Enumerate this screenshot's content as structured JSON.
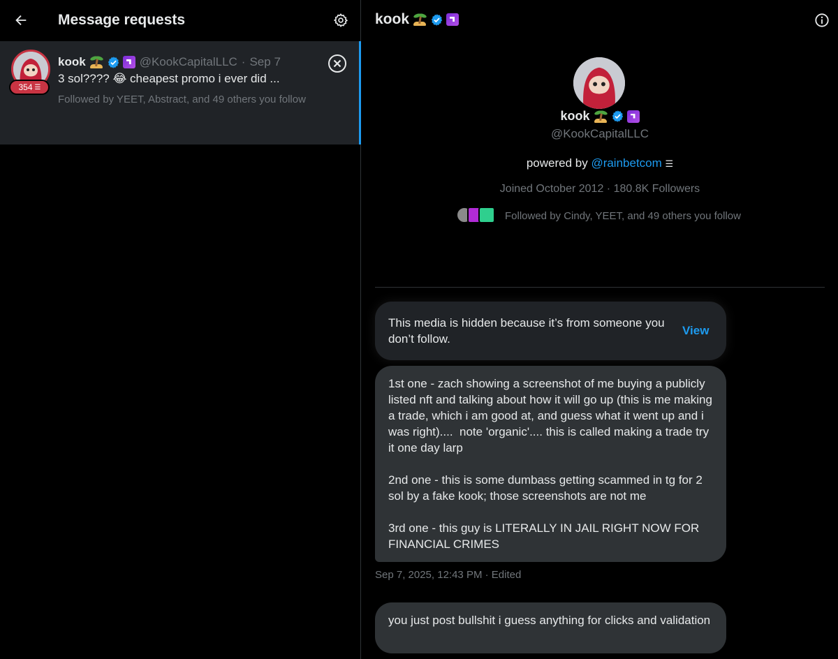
{
  "left_pane": {
    "title": "Message requests",
    "request": {
      "name": "kook",
      "handle": "@KookCapitalLLC",
      "separator": "·",
      "date": "Sep 7",
      "preview": "3 sol???? 😂 cheapest promo i ever did ...",
      "followed_by": "Followed by YEET, Abstract, and 49 others you follow",
      "badge_count": "354"
    }
  },
  "right_pane": {
    "header_name": "kook",
    "profile": {
      "name": "kook",
      "handle": "@KookCapitalLLC",
      "bio_prefix": "powered by",
      "bio_link": "@rainbetcom",
      "joined": "Joined October 2012 · 180.8K Followers",
      "followed_by": "Followed by Cindy, YEET, and 49 others you follow"
    },
    "messages": {
      "hidden_media_text": "This media is hidden because it’s from someone you don’t follow.",
      "view_label": "View",
      "long_message": "1st one - zach showing a screenshot of me buying a publicly listed nft and talking about how it will go up (this is me making a trade, which i am good at, and guess what it went up and i was right)....  note 'organic'.... this is called making a trade try it one day larp\n\n2nd one - this is some dumbass getting scammed in tg for 2 sol by a fake kook; those screenshots are not me\n\n3rd one - this guy is LITERALLY IN JAIL RIGHT NOW FOR FINANCIAL CRIMES",
      "timestamp": "Sep 7, 2025, 12:43 PM · Edited",
      "last_message": "you just post bullshit i guess anything for clicks and validation"
    }
  },
  "colors": {
    "accent": "#1d9bf0",
    "badge_red": "#c93443",
    "muted_text": "#71767b",
    "bubble": "#2f3336"
  },
  "icons": [
    "back-arrow-icon",
    "gear-icon",
    "close-circle-icon",
    "info-icon",
    "verified-icon",
    "palm-island-icon",
    "abstract-icon"
  ]
}
